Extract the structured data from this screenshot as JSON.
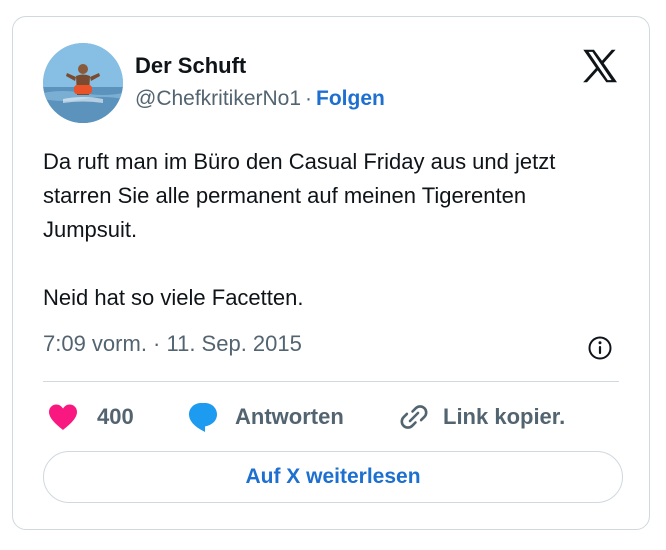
{
  "author": {
    "name": "Der Schuft",
    "handle": "@ChefkritikerNo1",
    "separator": "·",
    "follow_label": "Folgen"
  },
  "tweet": {
    "paragraphs": [
      "Da ruft man im Büro den Casual Friday aus und jetzt starren Sie alle permanent auf meinen Tigerenten Jumpsuit.",
      "Neid hat so viele Facetten."
    ],
    "timestamp": "7:09 vorm. · 11. Sep. 2015"
  },
  "actions": {
    "like_count": "400",
    "reply_label": "Antworten",
    "copy_link_label": "Link kopier."
  },
  "read_more_label": "Auf X weiterlesen",
  "icons": {
    "brand": "x-logo-icon",
    "info": "info-icon",
    "like": "heart-icon",
    "reply": "speech-bubble-icon",
    "link": "link-icon"
  },
  "colors": {
    "text": "#0f1419",
    "secondary": "#536471",
    "link_blue": "#1d6fd0",
    "heart": "#f91880",
    "reply_bubble": "#1d9bf0",
    "border": "#cfd9de"
  }
}
